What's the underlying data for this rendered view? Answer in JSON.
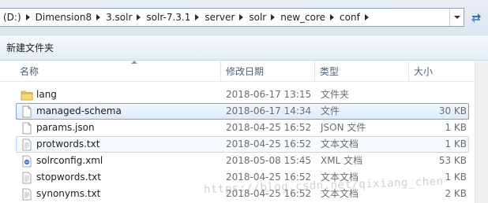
{
  "address_bar": {
    "crumbs": [
      {
        "label": "(D:)"
      },
      {
        "label": "Dimension8"
      },
      {
        "label": "3.solr"
      },
      {
        "label": "solr-7.3.1"
      },
      {
        "label": "server"
      },
      {
        "label": "solr"
      },
      {
        "label": "new_core"
      },
      {
        "label": "conf"
      }
    ],
    "dropdown_icon": "chevron-down-icon",
    "refresh_icon": "refresh-icon"
  },
  "toolbar": {
    "new_folder_label": "新建文件夹"
  },
  "columns": {
    "name": "名称",
    "date_modified": "修改日期",
    "type": "类型",
    "size": "大小"
  },
  "files": [
    {
      "name": "lang",
      "date": "2018-06-17 13:15",
      "type": "文件夹",
      "size": "",
      "icon": "folder-icon",
      "state": "normal"
    },
    {
      "name": "managed-schema",
      "date": "2018-06-17 14:34",
      "type": "文件",
      "size": "30 KB",
      "icon": "file-icon",
      "state": "selected"
    },
    {
      "name": "params.json",
      "date": "2018-04-25 16:52",
      "type": "JSON 文件",
      "size": "1 KB",
      "icon": "file-icon",
      "state": "normal"
    },
    {
      "name": "protwords.txt",
      "date": "2018-04-25 16:52",
      "type": "文本文档",
      "size": "1 KB",
      "icon": "text-file-icon",
      "state": "hover"
    },
    {
      "name": "solrconfig.xml",
      "date": "2018-05-08 15:45",
      "type": "XML 文档",
      "size": "53 KB",
      "icon": "xml-file-icon",
      "state": "normal"
    },
    {
      "name": "stopwords.txt",
      "date": "2018-04-25 16:52",
      "type": "文本文档",
      "size": "1 KB",
      "icon": "text-file-icon",
      "state": "normal"
    },
    {
      "name": "synonyms.txt",
      "date": "2018-04-25 16:52",
      "type": "文本文档",
      "size": "2 KB",
      "icon": "text-file-icon",
      "state": "normal"
    }
  ],
  "watermark": "https://blog.csdn.net/qixiang_chen",
  "colors": {
    "selection_fill": "#dcebfc",
    "selection_border": "#7da2ce",
    "folder_yellow": "#e8c25a",
    "header_text": "#4c607a"
  }
}
